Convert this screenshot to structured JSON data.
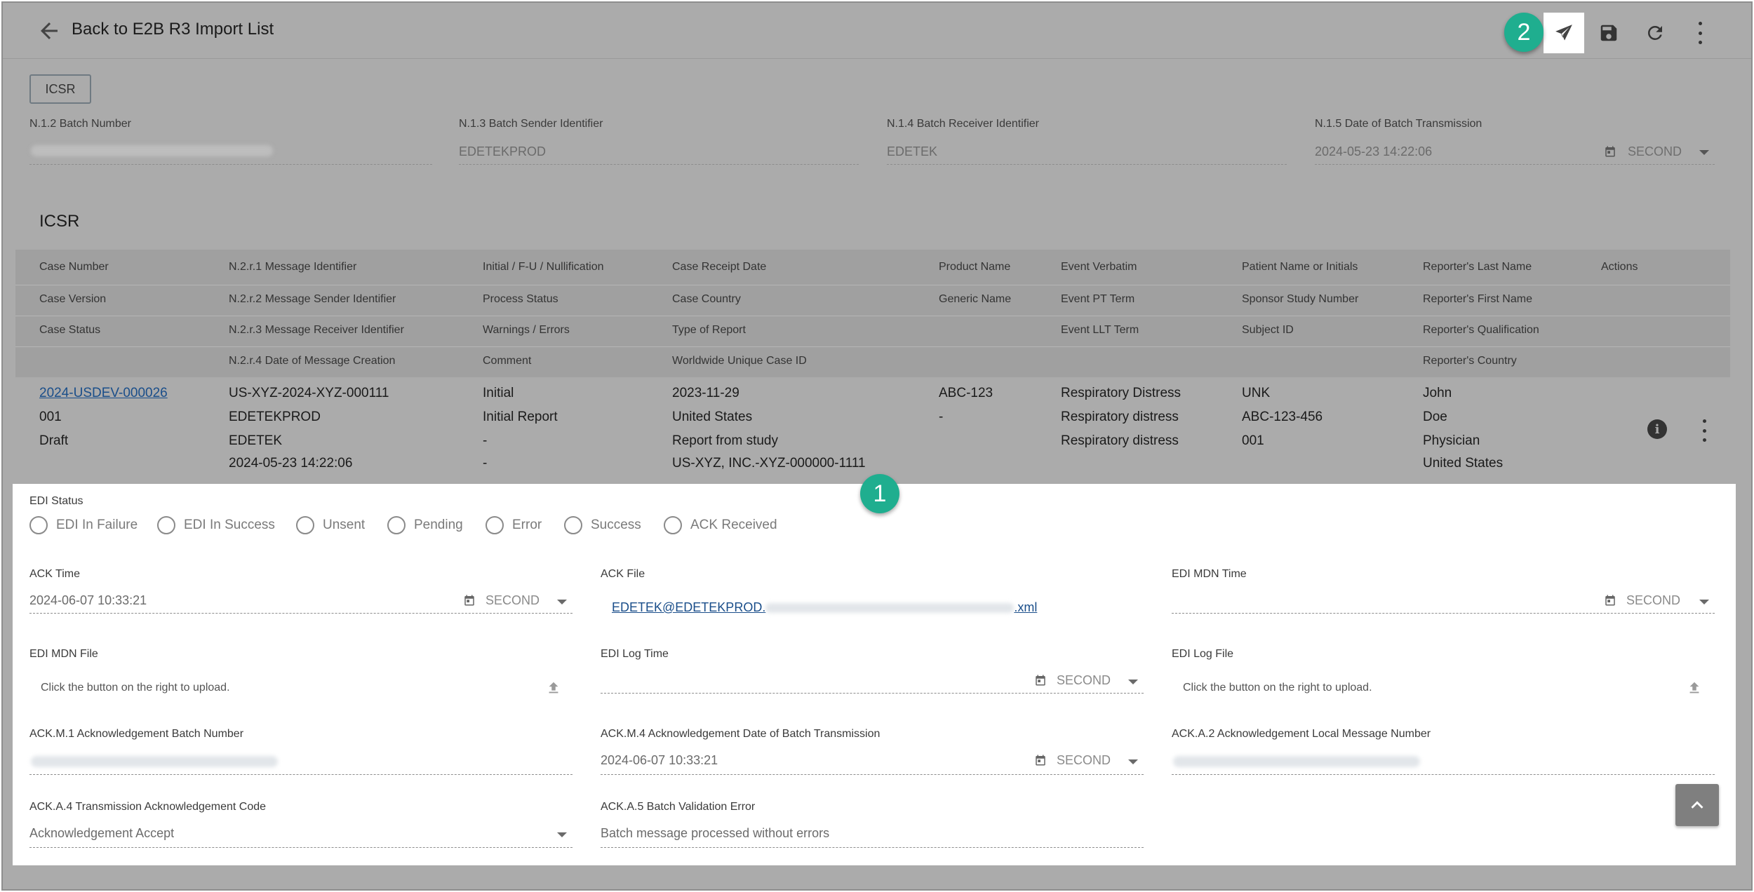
{
  "header": {
    "back_label": "Back to E2B R3 Import List",
    "toolbar": {
      "send_icon": "send-icon",
      "save_icon": "save-icon",
      "refresh_icon": "refresh-icon",
      "more_icon": "more-vert-icon"
    }
  },
  "badges": {
    "one": "1",
    "two": "2"
  },
  "tag_button": "ICSR",
  "batch": {
    "batch_number_label": "N.1.2 Batch Number",
    "sender_label": "N.1.3 Batch Sender Identifier",
    "sender_value": "EDETEKPROD",
    "receiver_label": "N.1.4 Batch Receiver Identifier",
    "receiver_value": "EDETEK",
    "date_label": "N.1.5 Date of Batch Transmission",
    "date_value": "2024-05-23 14:22:06",
    "date_unit": "SECOND"
  },
  "icsr_title": "ICSR",
  "table": {
    "headers": {
      "col1": [
        "Case Number",
        "Case Version",
        "Case Status",
        ""
      ],
      "col2": [
        "N.2.r.1 Message Identifier",
        "N.2.r.2 Message Sender Identifier",
        "N.2.r.3 Message Receiver Identifier",
        "N.2.r.4 Date of Message Creation"
      ],
      "col3": [
        "Initial / F-U / Nullification",
        "Process Status",
        "Warnings / Errors",
        "Comment"
      ],
      "col4": [
        "Case Receipt Date",
        "Case Country",
        "Type of Report",
        "Worldwide Unique Case ID"
      ],
      "col5": [
        "Product Name",
        "Generic Name",
        "",
        ""
      ],
      "col6": [
        "Event Verbatim",
        "Event PT Term",
        "Event LLT Term",
        ""
      ],
      "col7": [
        "Patient Name or Initials",
        "Sponsor Study Number",
        "Subject ID",
        ""
      ],
      "col8": [
        "Reporter's Last Name",
        "Reporter's First Name",
        "Reporter's Qualification",
        "Reporter's Country"
      ],
      "col9": [
        "Actions",
        "",
        "",
        ""
      ]
    },
    "row": {
      "col1": [
        "2024-USDEV-000026",
        "001",
        "Draft",
        ""
      ],
      "col2": [
        "US-XYZ-2024-XYZ-000111",
        "EDETEKPROD",
        "EDETEK",
        "2024-05-23 14:22:06"
      ],
      "col3": [
        "Initial",
        "Initial Report",
        "-",
        "-"
      ],
      "col4": [
        "2023-11-29",
        "United States",
        "Report from study",
        "US-XYZ, INC.-XYZ-000000-1111"
      ],
      "col5": [
        "ABC-123",
        "-",
        "",
        ""
      ],
      "col6": [
        "Respiratory Distress",
        "Respiratory distress",
        "Respiratory distress",
        ""
      ],
      "col7": [
        "UNK",
        "ABC-123-456",
        "001",
        ""
      ],
      "col8": [
        "John",
        "Doe",
        "Physician",
        "United States"
      ]
    }
  },
  "edi_status": {
    "label": "EDI Status",
    "options": [
      "EDI In Failure",
      "EDI In Success",
      "Unsent",
      "Pending",
      "Error",
      "Success",
      "ACK Received"
    ]
  },
  "ack": {
    "ack_time_label": "ACK Time",
    "ack_time_value": "2024-06-07 10:33:21",
    "ack_time_unit": "SECOND",
    "ack_file_label": "ACK File",
    "ack_file_prefix": "EDETEK@EDETEKPROD.",
    "ack_file_suffix": ".xml",
    "mdn_time_label": "EDI MDN Time",
    "mdn_time_unit": "SECOND",
    "mdn_file_label": "EDI MDN File",
    "mdn_file_hint": "Click the button on the right to upload.",
    "log_time_label": "EDI Log Time",
    "log_time_unit": "SECOND",
    "log_file_label": "EDI Log File",
    "log_file_hint": "Click the button on the right to upload.",
    "m1_label": "ACK.M.1 Acknowledgement Batch Number",
    "m4_label": "ACK.M.4 Acknowledgement Date of Batch Transmission",
    "m4_value": "2024-06-07 10:33:21",
    "m4_unit": "SECOND",
    "a2_label": "ACK.A.2 Acknowledgement Local Message Number",
    "a4_label": "ACK.A.4 Transmission Acknowledgement Code",
    "a4_value": "Acknowledgement Accept",
    "a5_label": "ACK.A.5 Batch Validation Error",
    "a5_value": "Batch message processed without errors"
  }
}
